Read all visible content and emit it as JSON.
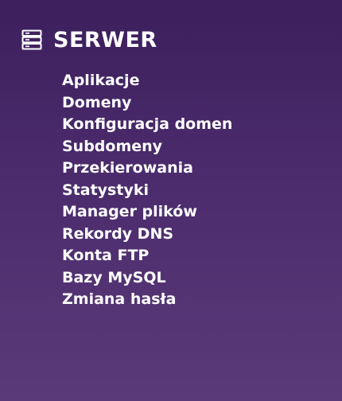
{
  "section": {
    "title": "SERWER",
    "icon": "server-icon"
  },
  "menu": {
    "items": [
      {
        "label": "Aplikacje"
      },
      {
        "label": "Domeny"
      },
      {
        "label": "Konfiguracja domen"
      },
      {
        "label": "Subdomeny"
      },
      {
        "label": "Przekierowania"
      },
      {
        "label": "Statystyki"
      },
      {
        "label": "Manager plików"
      },
      {
        "label": "Rekordy DNS"
      },
      {
        "label": "Konta FTP"
      },
      {
        "label": "Bazy MySQL"
      },
      {
        "label": "Zmiana hasła"
      }
    ]
  },
  "colors": {
    "background": "#4a2a6b",
    "text": "#ffffff"
  }
}
